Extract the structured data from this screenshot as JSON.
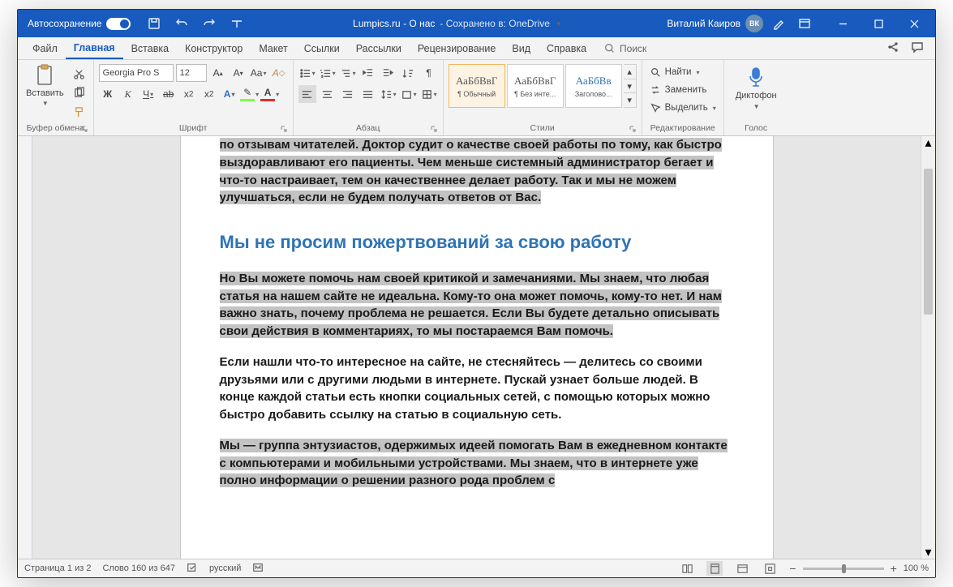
{
  "titlebar": {
    "autosave": "Автосохранение",
    "doc": "Lumpics.ru - О нас",
    "saved": "- Сохранено в: OneDrive",
    "user": "Виталий Каиров",
    "initials": "ВК"
  },
  "tabs": {
    "file": "Файл",
    "home": "Главная",
    "insert": "Вставка",
    "design": "Конструктор",
    "layout": "Макет",
    "refs": "Ссылки",
    "mail": "Рассылки",
    "review": "Рецензирование",
    "view": "Вид",
    "help": "Справка",
    "search": "Поиск"
  },
  "ribbon": {
    "clipboard": {
      "paste": "Вставить",
      "label": "Буфер обмена"
    },
    "font": {
      "name": "Georgia Pro S",
      "size": "12",
      "label": "Шрифт",
      "bold": "Ж",
      "italic": "К",
      "underline": "Ч",
      "strike": "ab"
    },
    "para": {
      "label": "Абзац"
    },
    "styles": {
      "label": "Стили",
      "preview": "АаБбВвГ",
      "preview2": "АаБбВв",
      "s1": "¶ Обычный",
      "s2": "¶ Без инте...",
      "s3": "Заголово..."
    },
    "editing": {
      "label": "Редактирование",
      "find": "Найти",
      "replace": "Заменить",
      "select": "Выделить"
    },
    "voice": {
      "dictate": "Диктофон",
      "label": "Голос"
    }
  },
  "document": {
    "p1": "по отзывам читателей. Доктор судит о качестве своей работы по тому, как быстро выздоравливают его пациенты. Чем меньше системный администратор бегает и что-то настраивает, тем он качественнее делает работу. Так и мы не можем улучшаться, если не будем получать ответов от Вас.",
    "h2": "Мы не просим пожертвований за свою работу",
    "p2": "Но Вы можете помочь нам своей критикой и замечаниями. Мы знаем, что любая статья на нашем сайте не идеальна. Кому-то она может помочь, кому-то нет. И нам важно знать, почему проблема не решается. Если Вы будете детально описывать свои действия в комментариях, то мы постараемся Вам помочь.",
    "p3": "Если нашли что-то интересное на сайте, не стесняйтесь — делитесь со своими друзьями или с другими людьми в интернете. Пускай узнает больше людей. В конце каждой статьи есть кнопки социальных сетей, с помощью которых можно быстро добавить ссылку на статью в социальную сеть.",
    "p4": "Мы — группа энтузиастов, одержимых идеей помогать Вам в ежедневном контакте с компьютерами и мобильными устройствами. Мы знаем, что в интернете уже полно информации о решении разного рода проблем с"
  },
  "status": {
    "page": "Страница 1 из 2",
    "words": "Слово 160 из 647",
    "lang": "русский",
    "zoom": "100 %"
  }
}
